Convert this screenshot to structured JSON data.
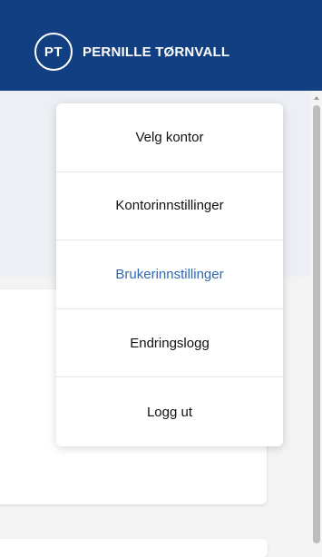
{
  "header": {
    "avatar_initials": "PT",
    "user_name": "PERNILLE TØRNVALL",
    "background_color": "#123f82"
  },
  "dropdown": {
    "items": [
      {
        "label": "Velg kontor"
      },
      {
        "label": "Kontorinnstillinger"
      },
      {
        "label": "Brukerinnstillinger",
        "highlighted": true,
        "color": "#2f67b3"
      },
      {
        "label": "Endringslogg"
      },
      {
        "label": "Logg ut"
      }
    ]
  }
}
